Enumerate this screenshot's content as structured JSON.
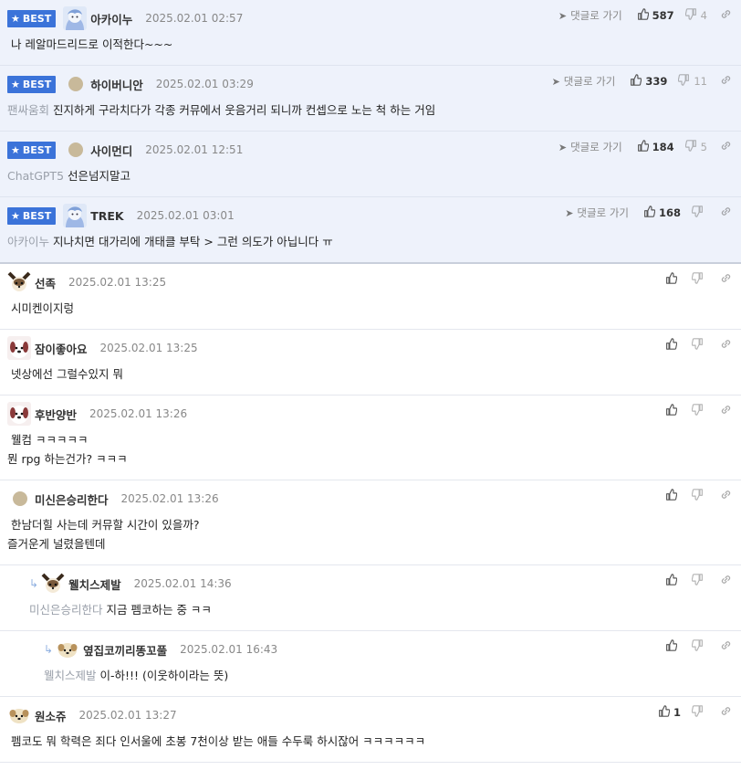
{
  "labels": {
    "best": "BEST",
    "reply_go": "댓글로 가기"
  },
  "best_comments": [
    {
      "nick": "아카이누",
      "avatar": "anime",
      "date": "2025.02.01 02:57",
      "likes": "587",
      "dislikes": "4",
      "prefix": "",
      "text": "나 레알마드리드로 이적한다~~~"
    },
    {
      "nick": "하이버니안",
      "avatar": "dot",
      "date": "2025.02.01 03:29",
      "likes": "339",
      "dislikes": "11",
      "prefix": "팬싸움회",
      "text": "진지하게 구라치다가 각종 커뮤에서 웃음거리 되니까 컨셉으로 노는 척 하는 거임"
    },
    {
      "nick": "사이먼디",
      "avatar": "dot",
      "date": "2025.02.01 12:51",
      "likes": "184",
      "dislikes": "5",
      "prefix": "ChatGPT5",
      "text": "선은넘지말고"
    },
    {
      "nick": "TREK",
      "avatar": "anime",
      "date": "2025.02.01 03:01",
      "likes": "168",
      "dislikes": "",
      "prefix": "아카이누",
      "text": "지나치면 대가리에 개태클 부탁 > 그런 의도가 아닙니다 ㅠ"
    }
  ],
  "comments": [
    {
      "nick": "선족",
      "avatar": "chihuahua",
      "date": "2025.02.01 13:25",
      "likes": "",
      "prefix": "",
      "text": "시미켄이지렁",
      "depth": 0
    },
    {
      "nick": "잠이좋아요",
      "avatar": "dog",
      "date": "2025.02.01 13:25",
      "likes": "",
      "prefix": "",
      "text": "넷상에선 그럴수있지 뭐",
      "depth": 0
    },
    {
      "nick": "후반양반",
      "avatar": "dog",
      "date": "2025.02.01 13:26",
      "likes": "",
      "prefix": "",
      "text": "웰컴 ㅋㅋㅋㅋㅋ\n뭔 rpg 하는건가? ㅋㅋㅋ",
      "depth": 0
    },
    {
      "nick": "미신은승리한다",
      "avatar": "dot",
      "date": "2025.02.01 13:26",
      "likes": "",
      "prefix": "",
      "text": "한남더힐 사는데 커뮤할 시간이 있을까?\n즐거운게 널렸을텐데",
      "depth": 0
    },
    {
      "nick": "웰치스제발",
      "avatar": "chihuahua",
      "date": "2025.02.01 14:36",
      "likes": "",
      "prefix": "미신은승리한다",
      "text": "지금 펨코하는 중 ㅋㅋ",
      "depth": 1
    },
    {
      "nick": "옆집코끼리똥꼬풀",
      "avatar": "puppy",
      "date": "2025.02.01 16:43",
      "likes": "",
      "prefix": "웰치스제발",
      "text": "이-하!!! (이웃하이라는 뜻)",
      "depth": 2
    },
    {
      "nick": "원소쥬",
      "avatar": "puppy",
      "date": "2025.02.01 13:27",
      "likes": "1",
      "prefix": "",
      "text": "펨코도 뭐 학력은 죄다 인서울에 초봉 7천이상 받는 애들 수두룩 하시잖어 ㅋㅋㅋㅋㅋㅋ",
      "depth": 0
    }
  ],
  "colors": {
    "best_bg": "#eef2fb",
    "badge": "#3b73d9",
    "reply_arrow": "#8fb0e0"
  }
}
